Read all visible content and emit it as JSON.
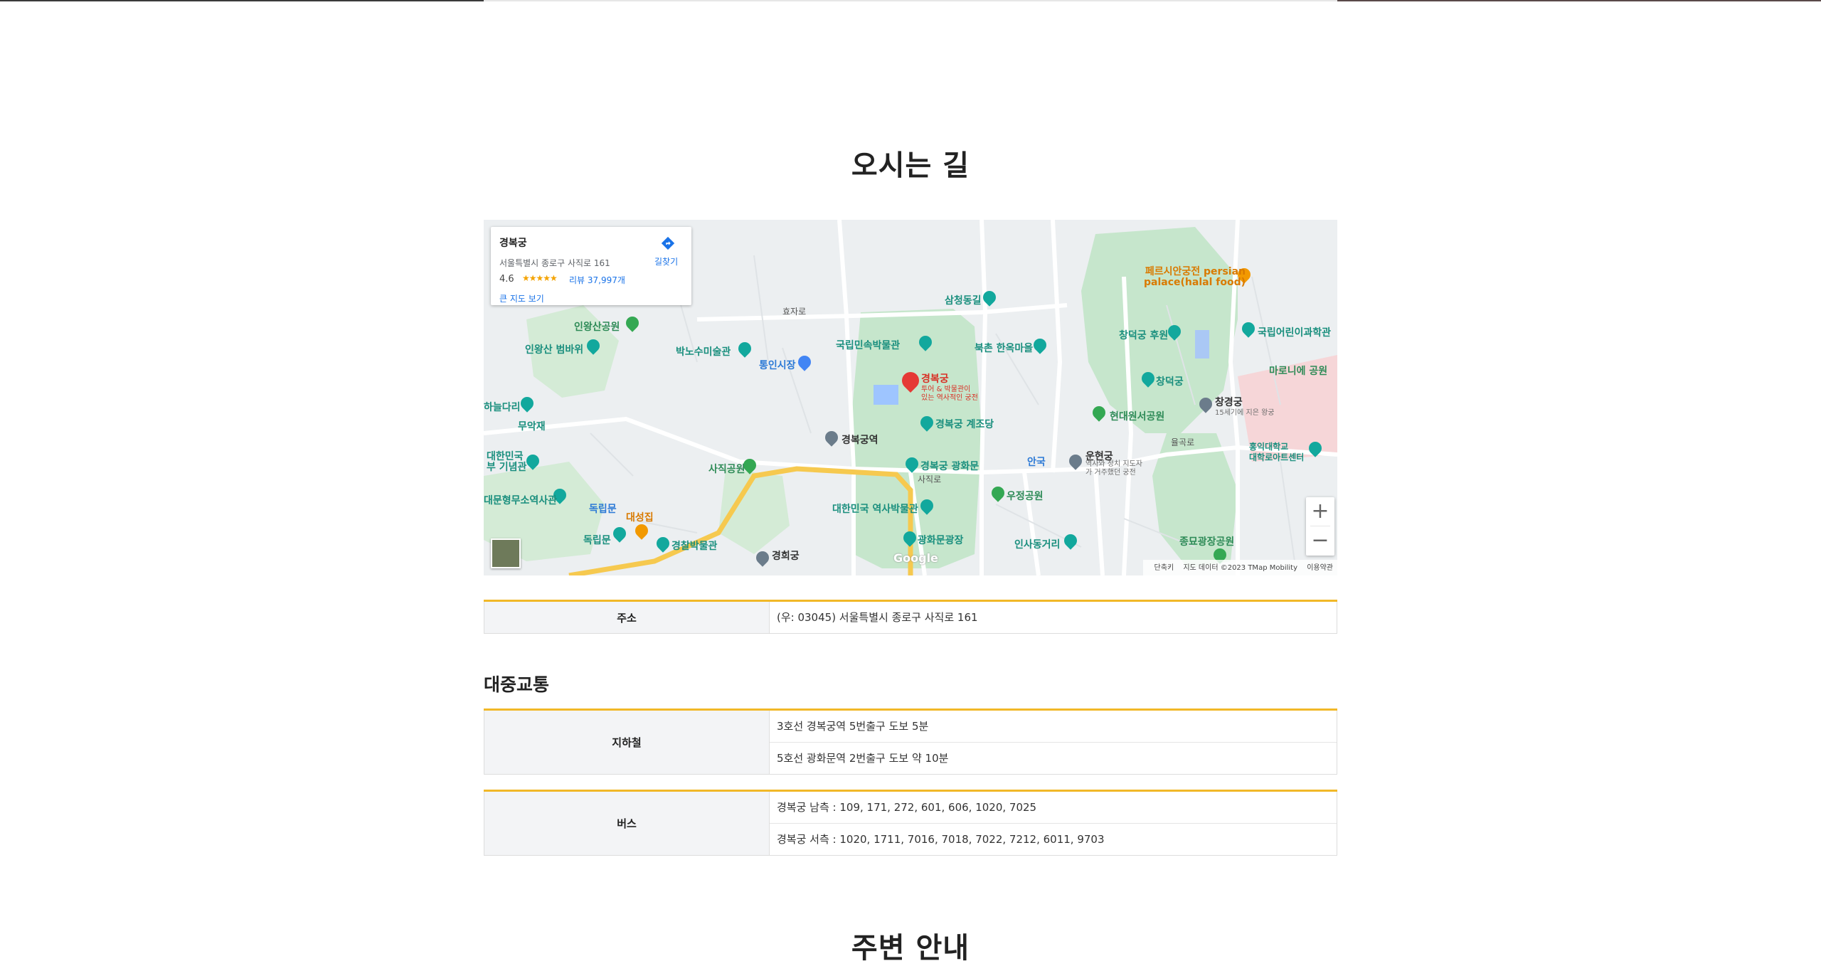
{
  "page": {
    "section_title": "오시는 길",
    "next_section_title": "주변 안내"
  },
  "map": {
    "place_name": "경복궁",
    "place_address": "서울특별시 종로구 사직로 161",
    "rating": "4.6",
    "stars": "★★★★★",
    "reviews_label": "리뷰 37,997개",
    "big_map_label": "큰 지도 보기",
    "directions_label": "길찾기",
    "zoom_in": "+",
    "zoom_out": "−",
    "google_label": "Google",
    "attribution": {
      "shortcuts": "단축키",
      "map_data": "지도 데이터 ©2023 TMap Mobility",
      "terms": "이용약관"
    },
    "main_marker": {
      "title": "경복궁",
      "subtitle_1": "투어 & 박물관이",
      "subtitle_2": "있는 역사적인 궁전"
    },
    "labels": {
      "gyeongbokgung_station": "경복궁역",
      "national_folk_museum": "국립민속박물관",
      "bukchon_hanok": "북촌 한옥마을",
      "samcheong_park": "삼청동길",
      "changdeokgung_garden": "창덕궁 후원",
      "changdeokgung": "창덕궁",
      "changgyeonggung": "창경궁",
      "changgyeonggung_sub": "15세기에 지은 왕궁",
      "hyundai_park": "현대원서공원",
      "inwangsan_park": "인왕산공원",
      "inwangsan_rock": "인왕산 범바위",
      "park_nosu": "박노수미술관",
      "tongin_market": "통인시장",
      "muakjae": "무악재",
      "sajik_park": "사직공원",
      "gyeongbokgung_gyejodang": "경복궁 계조당",
      "gwanghwamun": "경복궁 광화문",
      "museum_korea": "대한민국 역사박물관",
      "gwanghwamun_square": "광화문광장",
      "gyeonghuigung": "경희궁",
      "police_museum": "경찰박물관",
      "dongnimmun": "독립문",
      "dongnimmun_station": "독립문",
      "daeseongjip": "대성집",
      "independence_hall": "대한민국\n부 기념관",
      "seodaemun_prison": "대문형무소역사관",
      "woojeong_park": "우정공원",
      "insadong": "인사동거리",
      "unhyeongung": "운현궁",
      "unhyeongung_sub": "역사와 정치 지도자\n가 거주했던 궁전",
      "anguk": "안국",
      "jongmyo_park": "종묘광장공원",
      "persian_palace": "페르시안궁전 persian\npalace(halal food)",
      "children_museum": "국립어린이과학관",
      "marronnier_park": "마로니에 공원",
      "hongik_art": "홍익대학교\n대학로아트센터",
      "haneuldari": "하늘다리",
      "yulgokro": "율곡로",
      "sajikro": "사직로",
      "hyojaro": "효자로"
    }
  },
  "address_table": {
    "label": "주소",
    "value": "(우: 03045) 서울특별시 종로구 사직로 161"
  },
  "transit": {
    "heading": "대중교통",
    "subway": {
      "label": "지하철",
      "lines": [
        "3호선 경복궁역 5번출구 도보 5분",
        "5호선 광화문역 2번출구 도보 약 10분"
      ]
    },
    "bus": {
      "label": "버스",
      "lines": [
        "경복궁 남측 : 109, 171, 272, 601, 606, 1020, 7025",
        "경복궁 서측 : 1020, 1711, 7016, 7018, 7022, 7212, 6011, 9703"
      ]
    }
  },
  "colors": {
    "accent": "#f1b828",
    "map_park": "#c8e6c9",
    "map_road": "#ffffff",
    "map_highway": "#f6c94f",
    "header_bg": "#f3f4f6"
  }
}
